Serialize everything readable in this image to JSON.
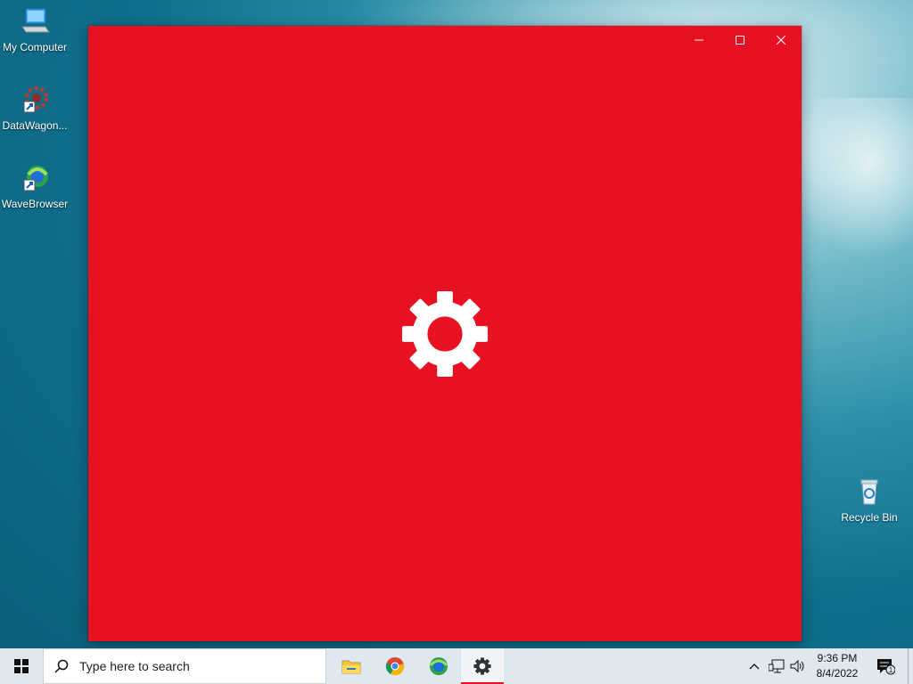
{
  "desktop": {
    "icons": [
      {
        "label": "My Computer",
        "icon": "my-computer-icon"
      },
      {
        "label": "DataWagon...",
        "icon": "datawagon-icon"
      },
      {
        "label": "WaveBrowser",
        "icon": "wavebrowser-icon"
      },
      {
        "label": "Recycle Bin",
        "icon": "recycle-bin-icon"
      }
    ]
  },
  "window": {
    "accent_color": "#e81123",
    "splash_icon": "gear-icon",
    "caption_buttons": [
      "minimize",
      "maximize",
      "close"
    ]
  },
  "taskbar": {
    "search_placeholder": "Type here to search",
    "pinned_apps": [
      {
        "name": "file-explorer",
        "icon": "folder-icon"
      },
      {
        "name": "chrome",
        "icon": "chrome-icon"
      },
      {
        "name": "wavebrowser",
        "icon": "wavebrowser-icon"
      },
      {
        "name": "settings",
        "icon": "gear-icon",
        "active": true
      }
    ],
    "time": "9:36 PM",
    "date": "8/4/2022",
    "notification_count": "1"
  }
}
